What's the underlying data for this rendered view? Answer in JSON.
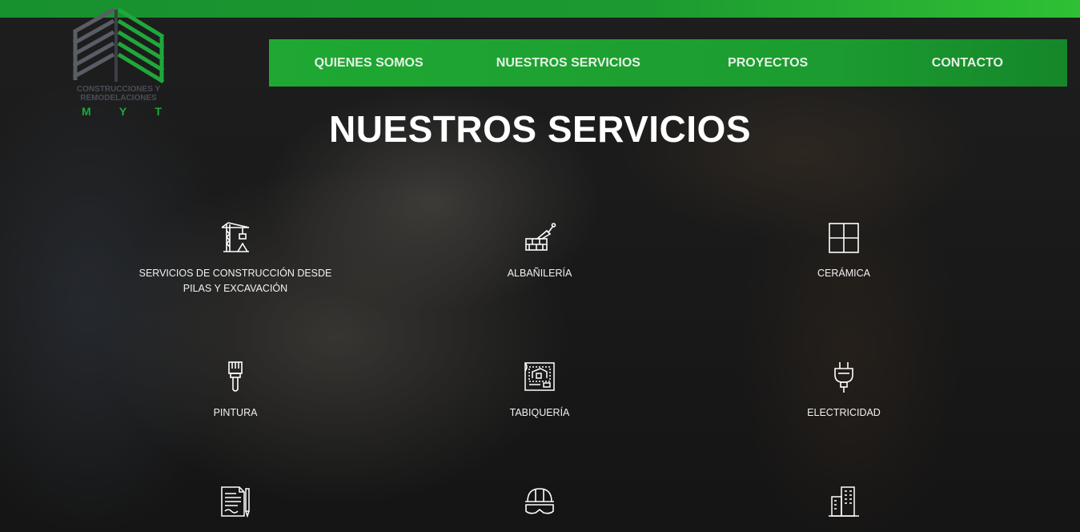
{
  "logo": {
    "text_line1": "CONSTRUCCIONES Y",
    "text_line2": "REMODELACIONES",
    "letters": [
      "M",
      "Y",
      "T"
    ]
  },
  "nav": {
    "items": [
      {
        "label": "QUIENES SOMOS"
      },
      {
        "label": "NUESTROS SERVICIOS"
      },
      {
        "label": "PROYECTOS"
      },
      {
        "label": "CONTACTO"
      }
    ]
  },
  "headline": "NUESTROS SERVICIOS",
  "services": [
    {
      "label": "SERVICIOS DE CONSTRUCCIÓN DESDE PILAS Y EXCAVACIÓN",
      "icon": "crane-icon"
    },
    {
      "label": "ALBAÑILERÍA",
      "icon": "trowel-bricks-icon"
    },
    {
      "label": "CERÁMICA",
      "icon": "tiles-icon"
    },
    {
      "label": "PINTURA",
      "icon": "paint-brush-icon"
    },
    {
      "label": "TABIQUERÍA",
      "icon": "blueprint-icon"
    },
    {
      "label": "ELECTRICIDAD",
      "icon": "plug-icon"
    },
    {
      "label": "",
      "icon": "document-pen-icon"
    },
    {
      "label": "",
      "icon": "helmet-goggles-icon"
    },
    {
      "label": "",
      "icon": "buildings-icon"
    }
  ],
  "colors": {
    "brand_green": "#1fa833",
    "top_bar": "#1c9a30",
    "text_light": "#ffffff"
  }
}
